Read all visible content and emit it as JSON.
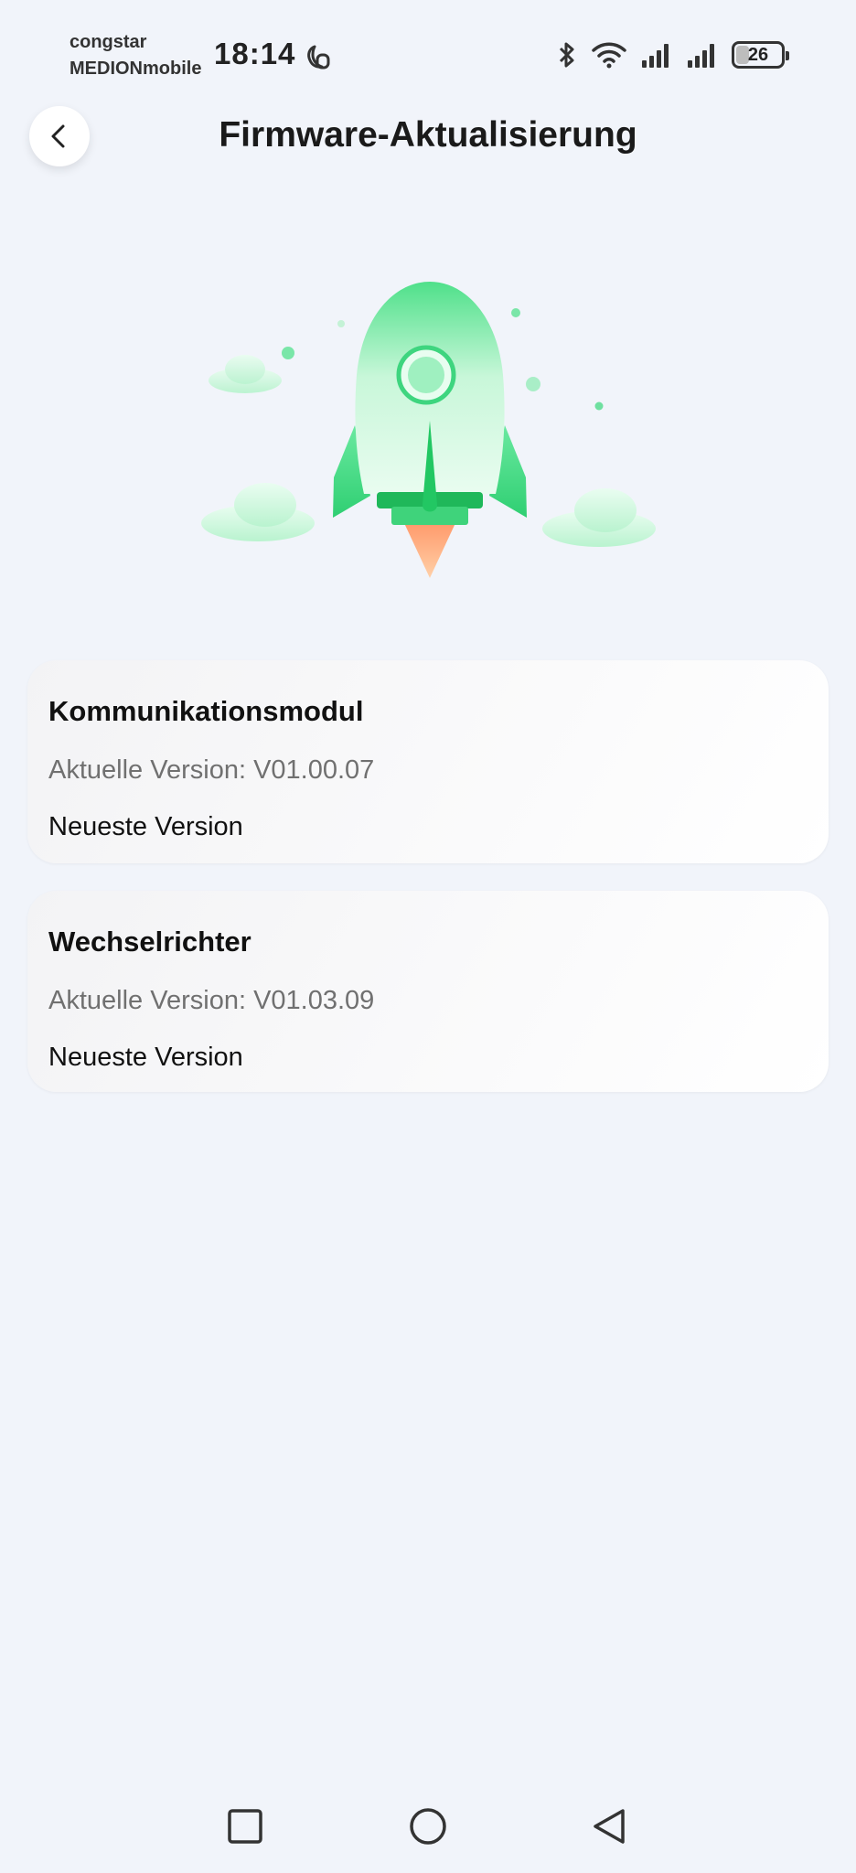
{
  "status_bar": {
    "carrier_line1": "congstar",
    "carrier_line2": "MEDIONmobile",
    "time": "18:14",
    "battery_level": "26",
    "icons": [
      "moon-icon",
      "bluetooth-icon",
      "wifi-icon",
      "signal-icon",
      "signal-icon",
      "battery-icon"
    ]
  },
  "header": {
    "title": "Firmware-Aktualisierung",
    "back_icon": "chevron-left-icon"
  },
  "devices": [
    {
      "name": "Kommunikationsmodul",
      "current_version": "Aktuelle Version: V01.00.07",
      "status": "Neueste Version"
    },
    {
      "name": "Wechselrichter",
      "current_version": "Aktuelle Version: V01.03.09",
      "status": "Neueste Version"
    }
  ],
  "nav_bar": {
    "icons": [
      "square-icon",
      "circle-icon",
      "triangle-back-icon"
    ]
  },
  "colors": {
    "background": "#f1f4fa",
    "accent_green": "#3ddc84",
    "flame": "#ff9a6b"
  }
}
